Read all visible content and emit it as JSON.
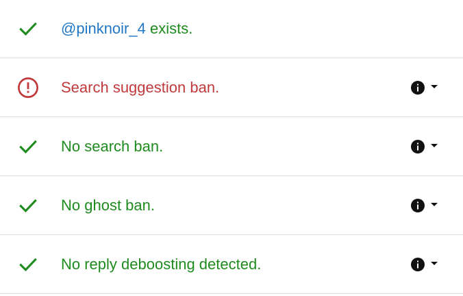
{
  "colors": {
    "ok": "#1e8b1e",
    "bad": "#c0393b",
    "handle": "#2277c4",
    "divider": "#dcdcdc"
  },
  "rows": [
    {
      "status": "ok",
      "icon": "check-icon",
      "handle": "@pinknoir_4",
      "text": " exists."
    },
    {
      "status": "bad",
      "icon": "alert-circle-icon",
      "text": "Search suggestion ban.",
      "info": true
    },
    {
      "status": "ok",
      "icon": "check-icon",
      "text": "No search ban.",
      "info": true
    },
    {
      "status": "ok",
      "icon": "check-icon",
      "text": "No ghost ban.",
      "info": true
    },
    {
      "status": "ok",
      "icon": "check-icon",
      "text": "No reply deboosting detected.",
      "info": true
    }
  ]
}
